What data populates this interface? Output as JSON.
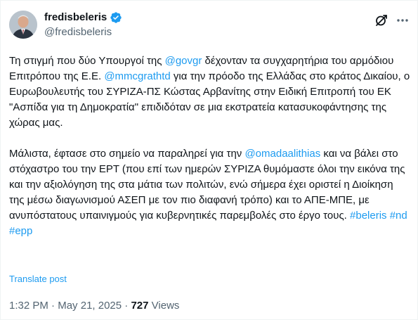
{
  "author": {
    "display_name": "fredisbeleris",
    "handle": "@fredisbeleris",
    "verified": true,
    "verified_color": "#1d9bf0"
  },
  "tweet": {
    "paragraph1": [
      {
        "type": "text",
        "value": "Τη στιγμή που δύο Υπουργοί της "
      },
      {
        "type": "mention",
        "value": "@govgr"
      },
      {
        "type": "text",
        "value": " δέχονταν τα συγχαρητήρια του αρμόδιου Επιτρόπου της Ε.Ε.  "
      },
      {
        "type": "mention",
        "value": "@mmcgrathtd"
      },
      {
        "type": "text",
        "value": " για την πρόοδο της Ελλάδας στο κράτος Δικαίου, ο Ευρωβουλευτής του ΣΥΡΙΖΑ-ΠΣ Κώστας Αρβανίτης στην Ειδική Επιτροπή του ΕΚ \"Ασπίδα για τη Δημοκρατία\" επιδιδόταν σε μια εκστρατεία κατασυκοφάντησης της χώρας μας."
      }
    ],
    "paragraph2": [
      {
        "type": "text",
        "value": "Μάλιστα, έφτασε στο σημείο να παραληρεί για την "
      },
      {
        "type": "mention",
        "value": "@omadaalithias"
      },
      {
        "type": "text",
        "value": " και να βάλει στο στόχαστρο του την ΕΡΤ (που επί των ημερών ΣΥΡΙΖΑ θυμόμαστε όλοι την εικόνα της και την αξιολόγηση της στα μάτια των πολιτών, ενώ σήμερα έχει οριστεί η Διοίκηση της μέσω διαγωνισμού ΑΣΕΠ με τον πιο διαφανή τρόπο) και το ΑΠΕ-ΜΠΕ, με ανυπόστατους υπαινιγμούς για κυβερνητικές παρεμβολές στο έργο τους. "
      },
      {
        "type": "hashtag",
        "value": "#beleris"
      },
      {
        "type": "text",
        "value": " "
      },
      {
        "type": "hashtag",
        "value": "#nd"
      },
      {
        "type": "text",
        "value": " "
      },
      {
        "type": "hashtag",
        "value": "#epp"
      }
    ],
    "translate_label": "Translate post"
  },
  "meta": {
    "time": "1:32 PM",
    "separator": "·",
    "date": "May 21, 2025",
    "views_count": "727",
    "views_label": "Views"
  },
  "icons": {
    "grok": "grok-icon",
    "more": "more-icon",
    "verified": "verified-badge-icon"
  },
  "colors": {
    "link": "#1d9bf0",
    "text": "#0f1419",
    "secondary": "#536471"
  }
}
